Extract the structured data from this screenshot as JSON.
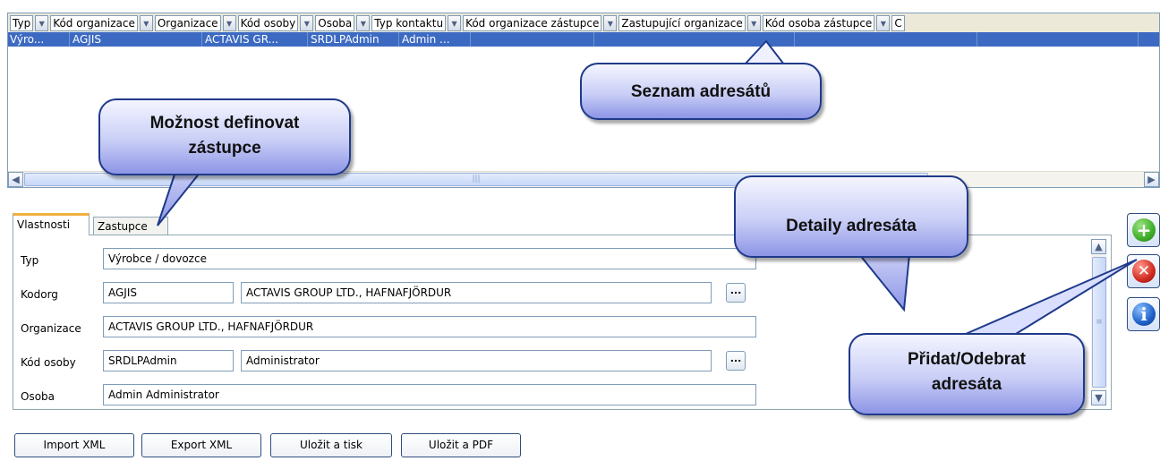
{
  "grid": {
    "columns": [
      "Typ",
      "Kód organizace",
      "Organizace",
      "Kód osoby",
      "Osoba",
      "Typ kontaktu",
      "Kód organizace zástupce",
      "Zastupující organizace",
      "Kód osoba zástupce",
      "C"
    ],
    "selected_row": {
      "typ": "Výro...",
      "kod_organizace": "AGJIS",
      "organizace": "ACTAVIS GR...",
      "kod_osoby": "SRDLPAdmin",
      "osoba": "Admin ..."
    }
  },
  "tabs": [
    "Vlastnosti",
    "Zastupce"
  ],
  "form": {
    "typ_label": "Typ",
    "typ_value": "Výrobce / dovozce",
    "kodorg_label": "Kodorg",
    "kodorg_code": "AGJIS",
    "kodorg_name": "ACTAVIS GROUP LTD., HAFNAFJÖRDUR",
    "organizace_label": "Organizace",
    "organizace_value": "ACTAVIS GROUP LTD., HAFNAFJÖRDUR",
    "kod_osoby_label": "Kód osoby",
    "kod_osoby_code": "SRDLPAdmin",
    "kod_osoby_name": "Administrator",
    "osoba_label": "Osoba",
    "osoba_value": "Admin Administrator",
    "browse_label": "..."
  },
  "buttons": {
    "import": "Import XML",
    "export": "Export XML",
    "save_print": "Uložit a tisk",
    "save_pdf": "Uložit a PDF"
  },
  "callouts": {
    "seznam": "Seznam adresátů",
    "zastupce_line1": "Možnost definovat",
    "zastupce_line2": "zástupce",
    "detaily": "Detaily adresáta",
    "pridat_line1": "Přidat/Odebrat",
    "pridat_line2": "adresáta"
  },
  "icons": {
    "add": "plus-icon",
    "remove": "delete-icon",
    "info": "info-icon"
  },
  "colors": {
    "selection": "#3c6ac2",
    "add_green": "#3fae2a",
    "remove_red": "#d12a1f",
    "info_blue": "#1d62c9",
    "callout_border": "#1f3a8a"
  }
}
